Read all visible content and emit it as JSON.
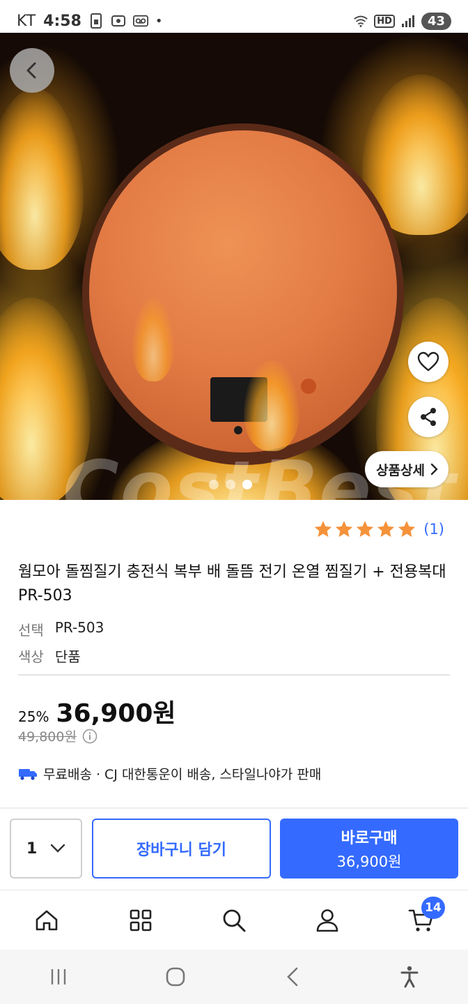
{
  "status_bar": {
    "carrier": "KT",
    "time": "4:58",
    "battery": "43",
    "network_badge": "HD",
    "dot": "•"
  },
  "hero": {
    "watermark": "CostBest",
    "detail_button_label": "상품상세",
    "page_indicator": {
      "count": 3,
      "active_index": 2
    },
    "icons": {
      "back": "back-arrow-icon",
      "wishlist": "heart-icon",
      "share": "share-icon"
    }
  },
  "product": {
    "rating_stars": 5,
    "rating_count": "(1)",
    "star_color": "#f5923a",
    "title": "웜모아 돌찜질기 충전식 복부 배 돌뜸 전기 온열 찜질기 + 전용복대 PR-503",
    "options": [
      {
        "key": "선택",
        "value": "PR-503"
      },
      {
        "key": "색상",
        "value": "단품"
      }
    ],
    "discount": "25%",
    "price": "36,900원",
    "original_price": "49,800원",
    "shipping_text": "무료배송 · CJ 대한통운이 배송, 스타일나야가 판매"
  },
  "actions": {
    "quantity": "1",
    "cart_label": "장바구니 담기",
    "buy_label": "바로구매",
    "buy_price": "36,900원",
    "accent_color": "#346aff"
  },
  "bottom_nav": {
    "items": [
      "home-icon",
      "category-icon",
      "search-icon",
      "account-icon",
      "cart-icon"
    ],
    "cart_badge": "14"
  },
  "system_nav": {
    "items": [
      "recents-icon",
      "home-circle-icon",
      "back-icon",
      "accessibility-icon"
    ]
  }
}
